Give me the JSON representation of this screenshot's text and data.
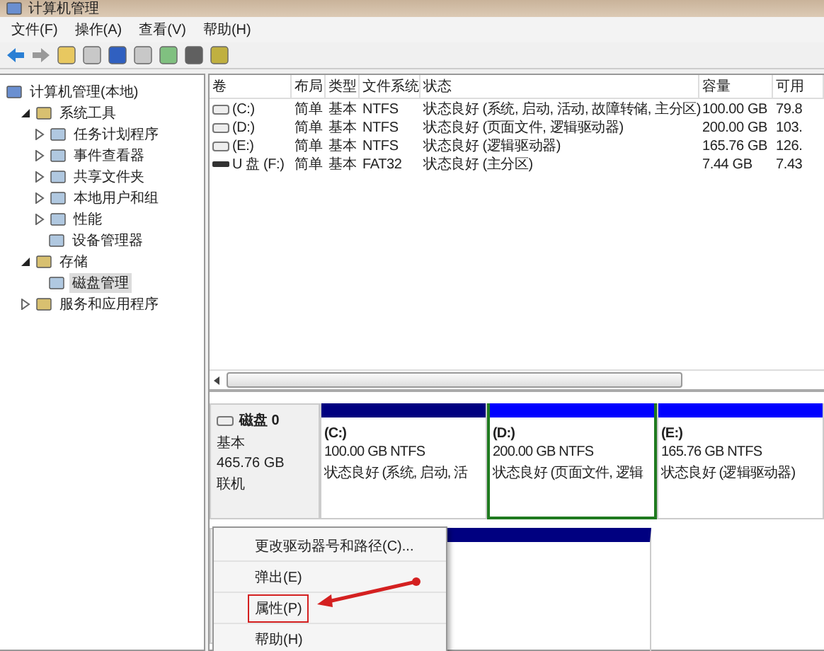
{
  "window": {
    "title": "计算机管理"
  },
  "menu_bar": [
    "文件(F)",
    "操作(A)",
    "查看(V)",
    "帮助(H)"
  ],
  "tree": [
    {
      "label": "计算机管理(本地)",
      "kind": "root",
      "selected": false,
      "children": [
        {
          "label": "系统工具",
          "kind": "node",
          "expanded": true,
          "selected": false,
          "children": [
            {
              "label": "任务计划程序",
              "kind": "node",
              "expanded": false,
              "selected": false
            },
            {
              "label": "事件查看器",
              "kind": "node",
              "expanded": false,
              "selected": false
            },
            {
              "label": "共享文件夹",
              "kind": "node",
              "expanded": false,
              "selected": false
            },
            {
              "label": "本地用户和组",
              "kind": "node",
              "expanded": false,
              "selected": false
            },
            {
              "label": "性能",
              "kind": "node",
              "expanded": false,
              "selected": false
            },
            {
              "label": "设备管理器",
              "kind": "leaf",
              "selected": false
            }
          ]
        },
        {
          "label": "存储",
          "kind": "node",
          "expanded": true,
          "selected": false,
          "children": [
            {
              "label": "磁盘管理",
              "kind": "leaf",
              "selected": true
            }
          ]
        },
        {
          "label": "服务和应用程序",
          "kind": "node",
          "expanded": false,
          "selected": false
        }
      ]
    }
  ],
  "table": {
    "columns": [
      "卷",
      "布局",
      "类型",
      "文件系统",
      "状态",
      "容量",
      "可用"
    ],
    "rows": [
      {
        "kind": "hdd",
        "cells": [
          "(C:)",
          "简单",
          "基本",
          "NTFS",
          "状态良好 (系统, 启动, 活动, 故障转储, 主分区)",
          "100.00 GB",
          "79.8"
        ]
      },
      {
        "kind": "hdd",
        "cells": [
          "(D:)",
          "简单",
          "基本",
          "NTFS",
          "状态良好 (页面文件, 逻辑驱动器)",
          "200.00 GB",
          "103."
        ]
      },
      {
        "kind": "hdd",
        "cells": [
          "(E:)",
          "简单",
          "基本",
          "NTFS",
          "状态良好 (逻辑驱动器)",
          "165.76 GB",
          "126."
        ]
      },
      {
        "kind": "usb",
        "cells": [
          "U 盘 (F:)",
          "简单",
          "基本",
          "FAT32",
          "状态良好 (主分区)",
          "7.44 GB",
          "7.43"
        ]
      }
    ]
  },
  "disk": {
    "name": "磁盘 0",
    "type": "基本",
    "size": "465.76 GB",
    "status": "联机",
    "partitions": [
      {
        "kind": "primary",
        "selected": false,
        "name": "(C:)",
        "size": "100.00 GB NTFS",
        "status": "状态良好 (系统, 启动, 活"
      },
      {
        "kind": "logical",
        "selected": true,
        "name": "(D:)",
        "size": "200.00 GB NTFS",
        "status": "状态良好 (页面文件, 逻辑"
      },
      {
        "kind": "logical",
        "selected": false,
        "name": "(E:)",
        "size": "165.76 GB NTFS",
        "status": "状态良好 (逻辑驱动器)"
      }
    ]
  },
  "context_menu": [
    {
      "label": "更改驱动器号和路径(C)...",
      "annotated": false
    },
    {
      "label": "弹出(E)",
      "annotated": false
    },
    {
      "label": "属性(P)",
      "annotated": true
    },
    {
      "label": "帮助(H)",
      "annotated": false
    }
  ]
}
